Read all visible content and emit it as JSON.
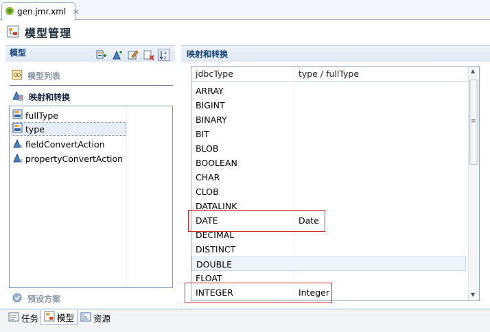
{
  "editor_tab": {
    "title": "gen.jmr.xml",
    "close_glyph": "✕"
  },
  "header": {
    "title": "模型管理"
  },
  "left_panel": {
    "label": "模型",
    "toolbar_icons": [
      "add-type-icon",
      "add-action-icon",
      "edit-icon",
      "delete-icon",
      "sort-az-icon"
    ],
    "sections": {
      "model_list": "模型列表",
      "mapping": "映射和转换",
      "preset": "预设方案"
    },
    "tree": [
      {
        "label": "fullType",
        "icon": "type-node-icon",
        "selected": false
      },
      {
        "label": "type",
        "icon": "type-node-icon",
        "selected": true
      },
      {
        "label": "fieldConvertAction",
        "icon": "action-node-icon",
        "selected": false
      },
      {
        "label": "propertyConvertAction",
        "icon": "action-node-icon",
        "selected": false
      }
    ]
  },
  "right_panel": {
    "label": "映射和转换",
    "columns": [
      "jdbcType",
      "type / fullType"
    ],
    "rows": [
      {
        "jdbc": "ARRAY",
        "type": ""
      },
      {
        "jdbc": "BIGINT",
        "type": ""
      },
      {
        "jdbc": "BINARY",
        "type": ""
      },
      {
        "jdbc": "BIT",
        "type": ""
      },
      {
        "jdbc": "BLOB",
        "type": ""
      },
      {
        "jdbc": "BOOLEAN",
        "type": ""
      },
      {
        "jdbc": "CHAR",
        "type": ""
      },
      {
        "jdbc": "CLOB",
        "type": ""
      },
      {
        "jdbc": "DATALINK",
        "type": ""
      },
      {
        "jdbc": "DATE",
        "type": "Date"
      },
      {
        "jdbc": "DECIMAL",
        "type": ""
      },
      {
        "jdbc": "DISTINCT",
        "type": ""
      },
      {
        "jdbc": "DOUBLE",
        "type": ""
      },
      {
        "jdbc": "FLOAT",
        "type": ""
      },
      {
        "jdbc": "INTEGER",
        "type": "Integer"
      }
    ]
  },
  "bottom_tabs": [
    {
      "label": "任务",
      "icon": "task-icon",
      "active": false
    },
    {
      "label": "模型",
      "icon": "model-icon",
      "active": true
    },
    {
      "label": "资源",
      "icon": "resource-icon",
      "active": false
    }
  ],
  "colors": {
    "accent": "#13427c",
    "highlight_box": "#d9262b"
  }
}
